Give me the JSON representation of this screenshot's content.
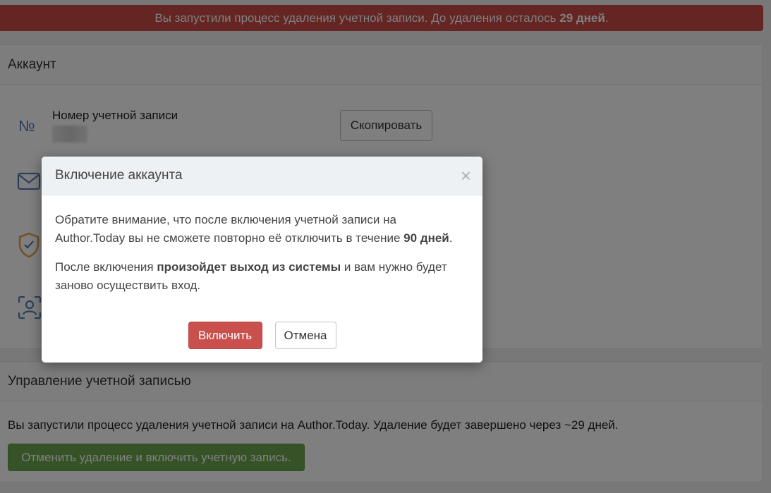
{
  "banner": {
    "text_before": "Вы запустили процесс удаления учетной записи. До удаления осталось ",
    "days_bold": "29 дней",
    "text_after": "."
  },
  "account_panel": {
    "title": "Аккаунт",
    "number_sign": "№",
    "number_label": "Номер учетной записи",
    "number_value": "",
    "copy_button": "Скопировать",
    "icons": [
      "envelope-icon",
      "shield-check-icon",
      "user-scan-icon"
    ]
  },
  "manage_panel": {
    "title": "Управление учетной записью",
    "text": "Вы запустили процесс удаления учетной записи на Author.Today. Удаление будет завершено через ~29 дней.",
    "cancel_delete_button": "Отменить удаление и включить учетную запись."
  },
  "modal": {
    "title": "Включение аккаунта",
    "close": "×",
    "p1_before": "Обратите внимание, что после включения учетной записи на Author.Today вы не сможете повторно её отключить в течение ",
    "p1_bold": "90 дней",
    "p1_after": ".",
    "p2_before": "После включения ",
    "p2_bold": "произойдет выход из системы",
    "p2_after": " и вам нужно будет заново осуществить вход.",
    "enable_button": "Включить",
    "cancel_button": "Отмена"
  },
  "colors": {
    "banner": "#ca4a47",
    "enable_button": "#c9504c",
    "success_button": "#6aa74f",
    "icon_blue": "#5b7cb6",
    "icon_orange": "#e0a041"
  }
}
